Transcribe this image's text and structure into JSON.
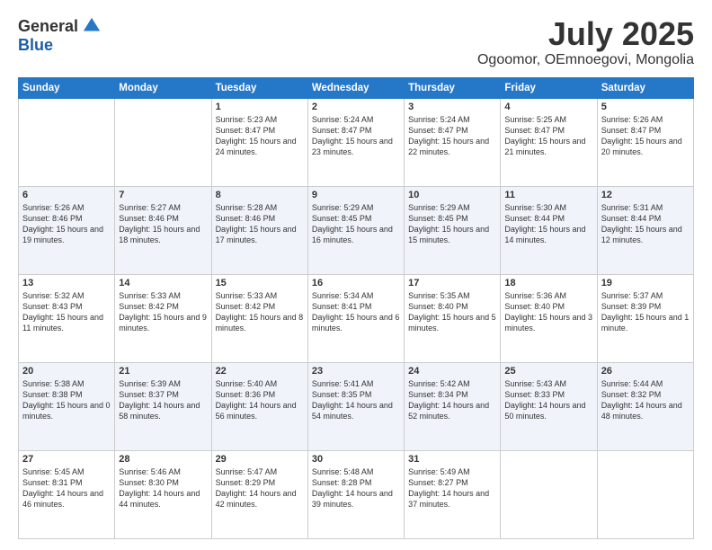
{
  "logo": {
    "general": "General",
    "blue": "Blue"
  },
  "header": {
    "month": "July 2025",
    "location": "Ogoomor, OEmnoegovi, Mongolia"
  },
  "days_of_week": [
    "Sunday",
    "Monday",
    "Tuesday",
    "Wednesday",
    "Thursday",
    "Friday",
    "Saturday"
  ],
  "weeks": [
    [
      {
        "day": "",
        "info": ""
      },
      {
        "day": "",
        "info": ""
      },
      {
        "day": "1",
        "info": "Sunrise: 5:23 AM\nSunset: 8:47 PM\nDaylight: 15 hours and 24 minutes."
      },
      {
        "day": "2",
        "info": "Sunrise: 5:24 AM\nSunset: 8:47 PM\nDaylight: 15 hours and 23 minutes."
      },
      {
        "day": "3",
        "info": "Sunrise: 5:24 AM\nSunset: 8:47 PM\nDaylight: 15 hours and 22 minutes."
      },
      {
        "day": "4",
        "info": "Sunrise: 5:25 AM\nSunset: 8:47 PM\nDaylight: 15 hours and 21 minutes."
      },
      {
        "day": "5",
        "info": "Sunrise: 5:26 AM\nSunset: 8:47 PM\nDaylight: 15 hours and 20 minutes."
      }
    ],
    [
      {
        "day": "6",
        "info": "Sunrise: 5:26 AM\nSunset: 8:46 PM\nDaylight: 15 hours and 19 minutes."
      },
      {
        "day": "7",
        "info": "Sunrise: 5:27 AM\nSunset: 8:46 PM\nDaylight: 15 hours and 18 minutes."
      },
      {
        "day": "8",
        "info": "Sunrise: 5:28 AM\nSunset: 8:46 PM\nDaylight: 15 hours and 17 minutes."
      },
      {
        "day": "9",
        "info": "Sunrise: 5:29 AM\nSunset: 8:45 PM\nDaylight: 15 hours and 16 minutes."
      },
      {
        "day": "10",
        "info": "Sunrise: 5:29 AM\nSunset: 8:45 PM\nDaylight: 15 hours and 15 minutes."
      },
      {
        "day": "11",
        "info": "Sunrise: 5:30 AM\nSunset: 8:44 PM\nDaylight: 15 hours and 14 minutes."
      },
      {
        "day": "12",
        "info": "Sunrise: 5:31 AM\nSunset: 8:44 PM\nDaylight: 15 hours and 12 minutes."
      }
    ],
    [
      {
        "day": "13",
        "info": "Sunrise: 5:32 AM\nSunset: 8:43 PM\nDaylight: 15 hours and 11 minutes."
      },
      {
        "day": "14",
        "info": "Sunrise: 5:33 AM\nSunset: 8:42 PM\nDaylight: 15 hours and 9 minutes."
      },
      {
        "day": "15",
        "info": "Sunrise: 5:33 AM\nSunset: 8:42 PM\nDaylight: 15 hours and 8 minutes."
      },
      {
        "day": "16",
        "info": "Sunrise: 5:34 AM\nSunset: 8:41 PM\nDaylight: 15 hours and 6 minutes."
      },
      {
        "day": "17",
        "info": "Sunrise: 5:35 AM\nSunset: 8:40 PM\nDaylight: 15 hours and 5 minutes."
      },
      {
        "day": "18",
        "info": "Sunrise: 5:36 AM\nSunset: 8:40 PM\nDaylight: 15 hours and 3 minutes."
      },
      {
        "day": "19",
        "info": "Sunrise: 5:37 AM\nSunset: 8:39 PM\nDaylight: 15 hours and 1 minute."
      }
    ],
    [
      {
        "day": "20",
        "info": "Sunrise: 5:38 AM\nSunset: 8:38 PM\nDaylight: 15 hours and 0 minutes."
      },
      {
        "day": "21",
        "info": "Sunrise: 5:39 AM\nSunset: 8:37 PM\nDaylight: 14 hours and 58 minutes."
      },
      {
        "day": "22",
        "info": "Sunrise: 5:40 AM\nSunset: 8:36 PM\nDaylight: 14 hours and 56 minutes."
      },
      {
        "day": "23",
        "info": "Sunrise: 5:41 AM\nSunset: 8:35 PM\nDaylight: 14 hours and 54 minutes."
      },
      {
        "day": "24",
        "info": "Sunrise: 5:42 AM\nSunset: 8:34 PM\nDaylight: 14 hours and 52 minutes."
      },
      {
        "day": "25",
        "info": "Sunrise: 5:43 AM\nSunset: 8:33 PM\nDaylight: 14 hours and 50 minutes."
      },
      {
        "day": "26",
        "info": "Sunrise: 5:44 AM\nSunset: 8:32 PM\nDaylight: 14 hours and 48 minutes."
      }
    ],
    [
      {
        "day": "27",
        "info": "Sunrise: 5:45 AM\nSunset: 8:31 PM\nDaylight: 14 hours and 46 minutes."
      },
      {
        "day": "28",
        "info": "Sunrise: 5:46 AM\nSunset: 8:30 PM\nDaylight: 14 hours and 44 minutes."
      },
      {
        "day": "29",
        "info": "Sunrise: 5:47 AM\nSunset: 8:29 PM\nDaylight: 14 hours and 42 minutes."
      },
      {
        "day": "30",
        "info": "Sunrise: 5:48 AM\nSunset: 8:28 PM\nDaylight: 14 hours and 39 minutes."
      },
      {
        "day": "31",
        "info": "Sunrise: 5:49 AM\nSunset: 8:27 PM\nDaylight: 14 hours and 37 minutes."
      },
      {
        "day": "",
        "info": ""
      },
      {
        "day": "",
        "info": ""
      }
    ]
  ]
}
